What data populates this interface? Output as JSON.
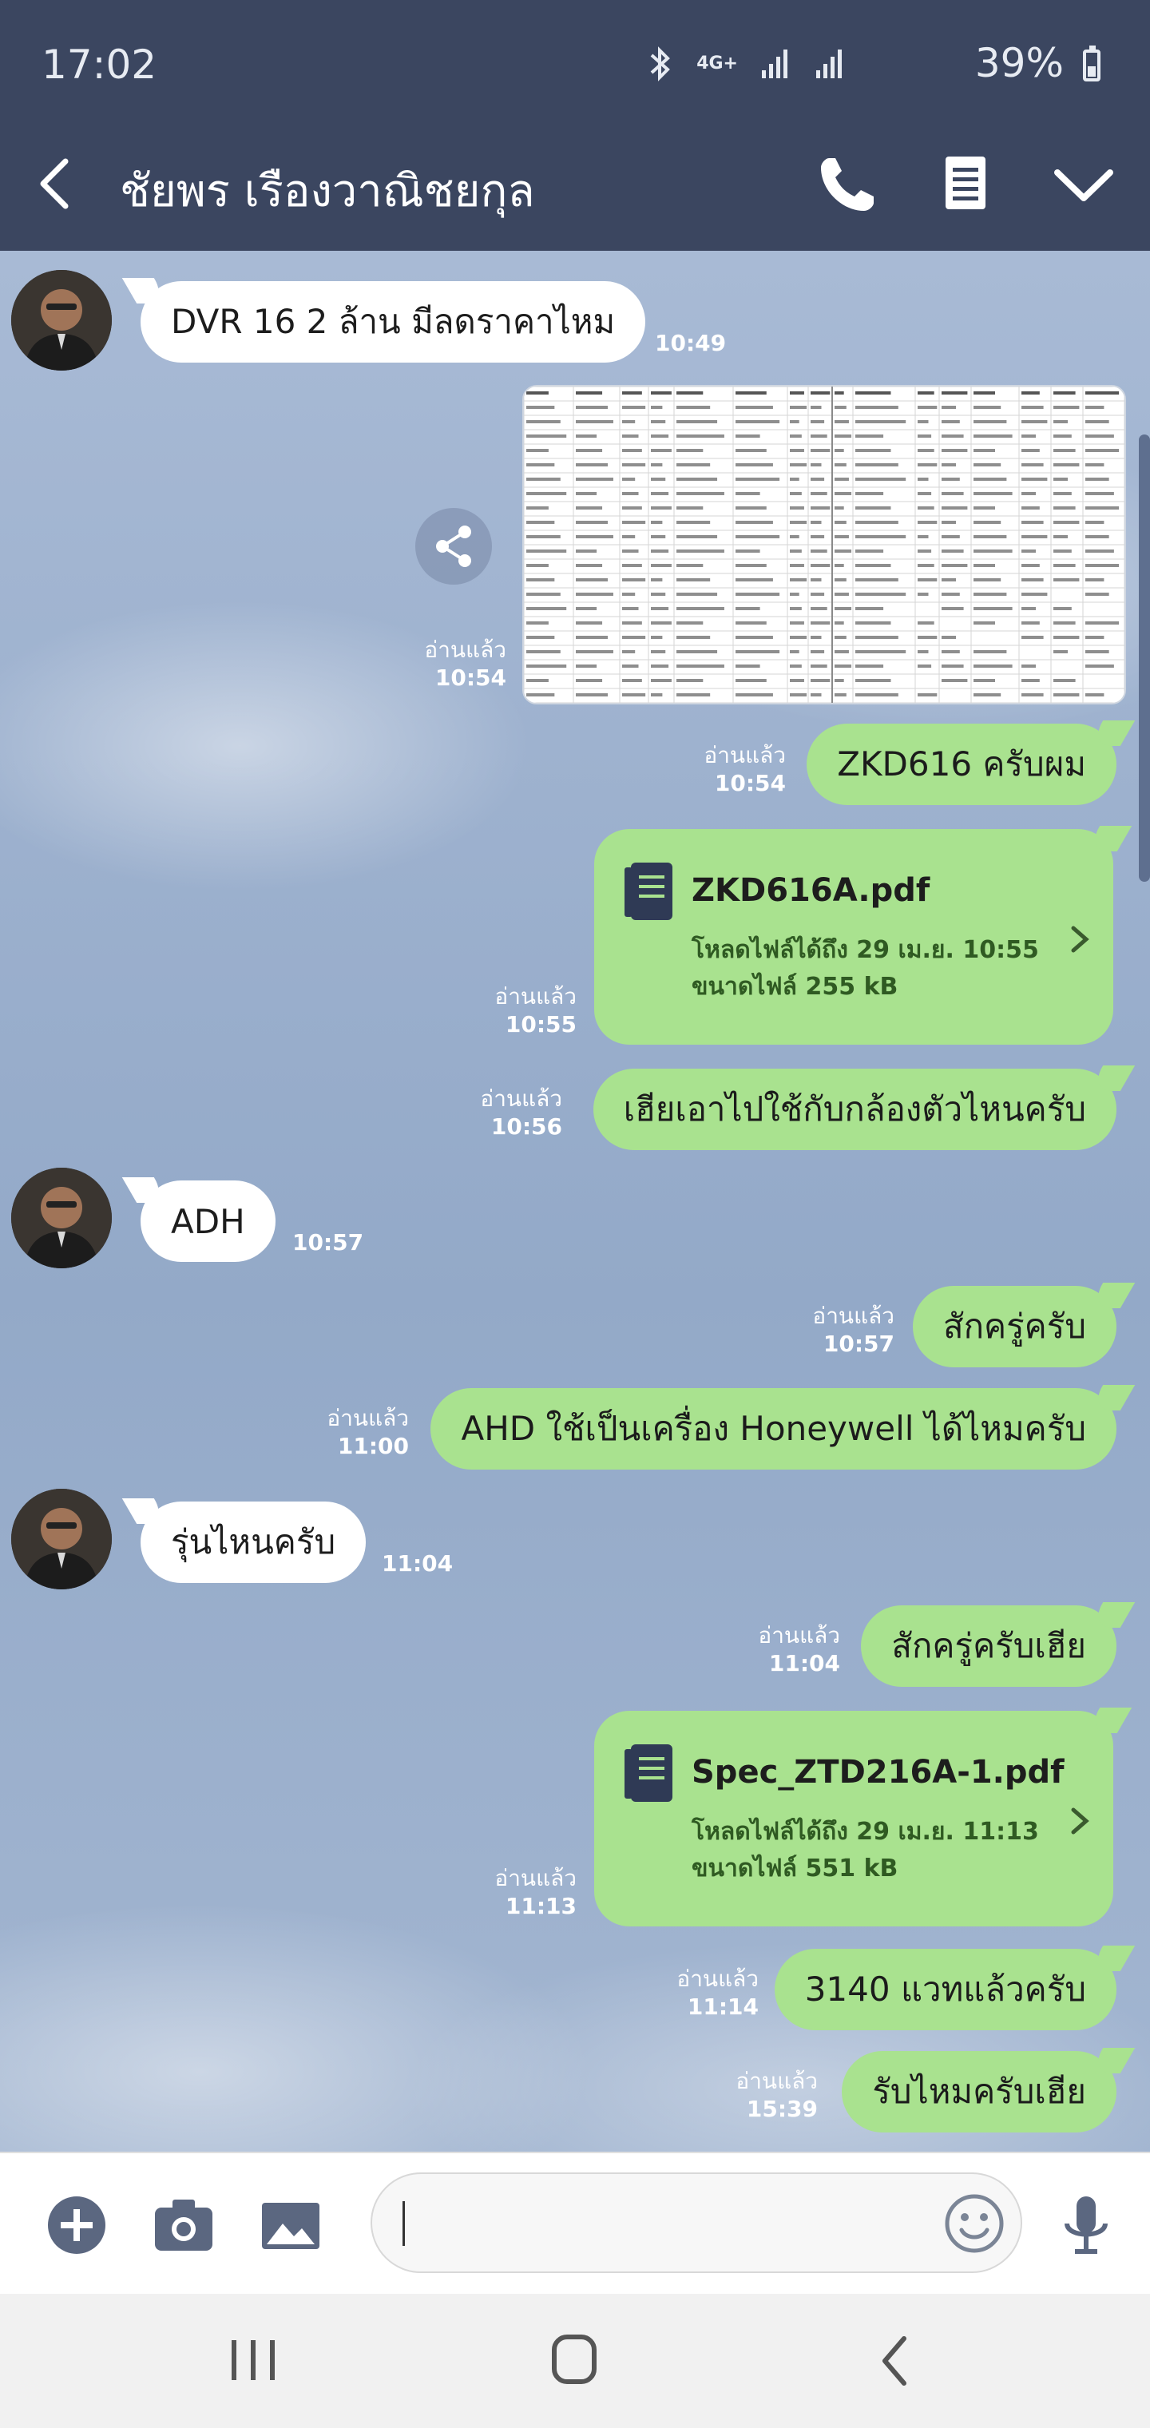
{
  "status": {
    "time": "17:02",
    "network": "4G+",
    "battery": "39%"
  },
  "header": {
    "title": "ชัยพร เรืองวาณิชยกุล"
  },
  "colors": {
    "header_bg": "#3b4660",
    "outgoing_bubble": "#a9e28f",
    "incoming_bubble": "#ffffff"
  },
  "read_label": "อ่านแล้ว",
  "messages": {
    "m1": {
      "text": "DVR 16 2 ล้าน มีลดราคาไหม",
      "time": "10:49"
    },
    "m2": {
      "time": "10:54"
    },
    "m3": {
      "text": "ZKD616 ครับผม",
      "time": "10:54"
    },
    "m4": {
      "file_name": "ZKD616A.pdf",
      "download_info": "โหลดไฟล์ได้ถึง 29 เม.ย. 10:55",
      "size_info": "ขนาดไฟล์ 255 kB",
      "time": "10:55"
    },
    "m5": {
      "text": "เฮียเอาไปใช้กับกล้องตัวไหนครับ",
      "time": "10:56"
    },
    "m6": {
      "text": "ADH",
      "time": "10:57"
    },
    "m7": {
      "text": "สักครู่ครับ",
      "time": "10:57"
    },
    "m8": {
      "text": "AHD ใช้เป็นเครื่อง Honeywell ได้ไหมครับ",
      "time": "11:00"
    },
    "m9": {
      "text": "รุ่นไหนครับ",
      "time": "11:04"
    },
    "m10": {
      "text": "สักครู่ครับเฮีย",
      "time": "11:04"
    },
    "m11": {
      "file_name": "Spec_ZTD216A-1.pdf",
      "download_info": "โหลดไฟล์ได้ถึง 29 เม.ย. 11:13",
      "size_info": "ขนาดไฟล์ 551 kB",
      "time": "11:13"
    },
    "m12": {
      "text": "3140 แวทแล้วครับ",
      "time": "11:14"
    },
    "m13": {
      "text": "รับไหมครับเฮีย",
      "time": "15:39"
    }
  },
  "input": {
    "placeholder": "",
    "value": ""
  },
  "icons": {
    "header": [
      "back-arrow-icon",
      "phone-icon",
      "note-icon",
      "chevron-down-icon"
    ],
    "input_bar": [
      "plus-icon",
      "camera-icon",
      "image-icon",
      "emoji-icon",
      "microphone-icon"
    ],
    "nav": [
      "recent-apps-icon",
      "home-icon",
      "back-icon"
    ]
  }
}
